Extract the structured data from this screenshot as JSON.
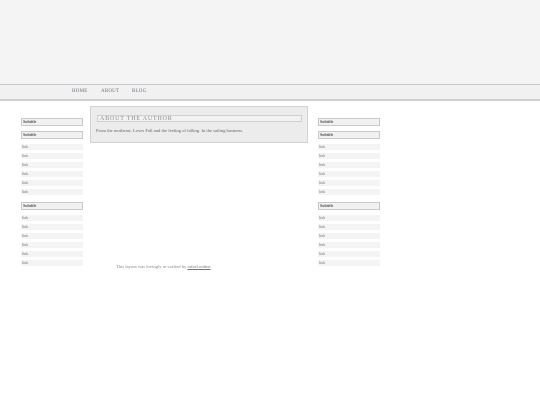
{
  "nav": {
    "items": [
      "HOME",
      "ABOUT",
      "BLOG"
    ]
  },
  "main": {
    "title": "ABOUT THE AUTHOR",
    "text": "From the northeast. Loves Fall and the feeling of falling. In the sailing business."
  },
  "left_sidebar": {
    "groups": [
      {
        "title": "Subtitle",
        "links": []
      },
      {
        "title": "Subtitle",
        "links": [
          "link",
          "link",
          "link",
          "link",
          "link",
          "link"
        ]
      },
      {
        "title": "Subtitle",
        "links": [
          "link",
          "link",
          "link",
          "link",
          "link",
          "link"
        ]
      }
    ]
  },
  "right_sidebar": {
    "groups": [
      {
        "title": "Subtitle",
        "links": []
      },
      {
        "title": "Subtitle",
        "links": [
          "link",
          "link",
          "link",
          "link",
          "link",
          "link"
        ]
      },
      {
        "title": "Subtitle",
        "links": [
          "link",
          "link",
          "link",
          "link",
          "link",
          "link"
        ]
      }
    ]
  },
  "footer": {
    "text": "This layout was lovingly re-crafted by",
    "link_text": "rafael.online"
  }
}
